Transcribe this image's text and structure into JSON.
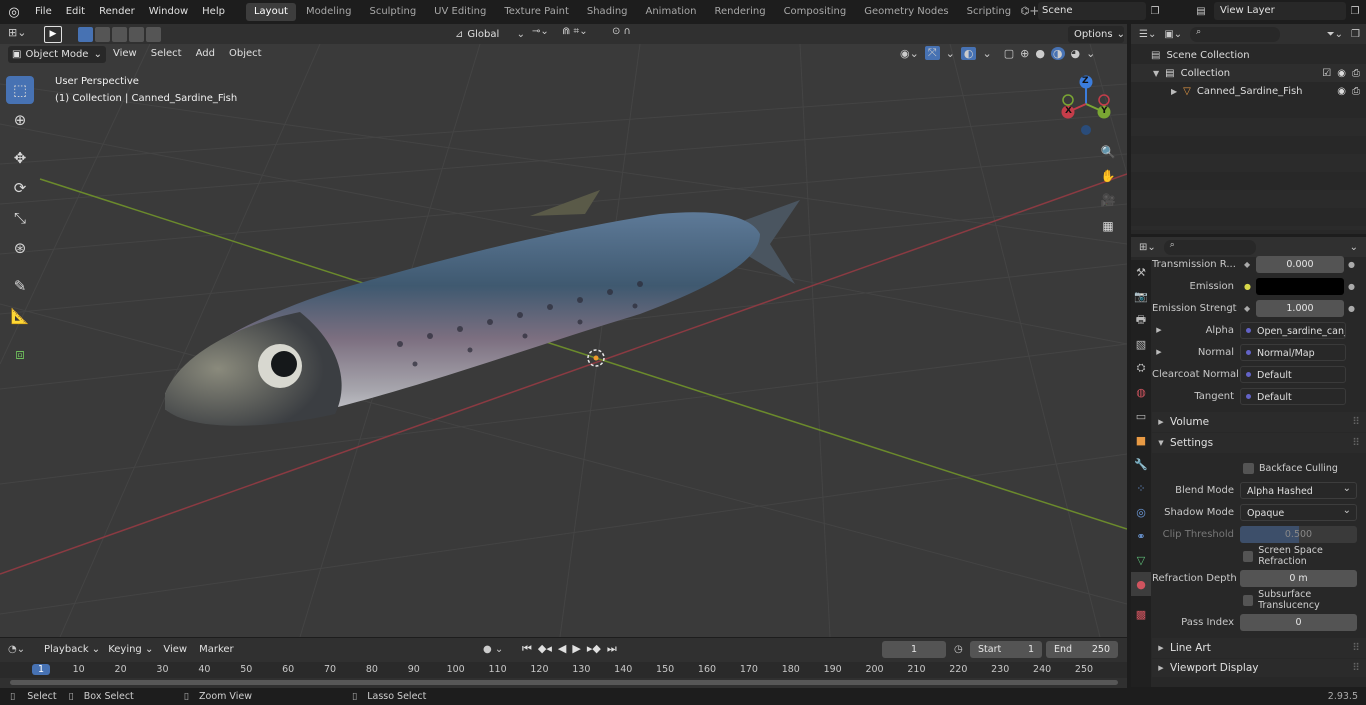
{
  "menu": {
    "items": [
      "File",
      "Edit",
      "Render",
      "Window",
      "Help"
    ]
  },
  "workspaces": {
    "tabs": [
      "Layout",
      "Modeling",
      "Sculpting",
      "UV Editing",
      "Texture Paint",
      "Shading",
      "Animation",
      "Rendering",
      "Compositing",
      "Geometry Nodes",
      "Scripting"
    ],
    "active": "Layout",
    "add": "+"
  },
  "scene": {
    "name": "Scene",
    "view_layer": "View Layer"
  },
  "header": {
    "transform_orientation": "Global",
    "options": "Options"
  },
  "viewport_header": {
    "mode": "Object Mode",
    "menus": [
      "View",
      "Select",
      "Add",
      "Object"
    ]
  },
  "viewport": {
    "perspective_label": "User Perspective",
    "collection_label": "(1) Collection | Canned_Sardine_Fish"
  },
  "gizmo": {
    "z": "Z",
    "y": "Y",
    "x": "X"
  },
  "outliner": {
    "root": "Scene Collection",
    "collection": "Collection",
    "object": "Canned_Sardine_Fish"
  },
  "properties": {
    "rows": [
      {
        "label": "Transmission R...",
        "value": "0.000"
      },
      {
        "label": "Emission",
        "value": ""
      },
      {
        "label": "Emission Strengt",
        "value": "1.000"
      }
    ],
    "links": [
      {
        "label": "Alpha",
        "value": "Open_sardine_can_s..."
      },
      {
        "label": "Normal",
        "value": "Normal/Map"
      },
      {
        "label": "Clearcoat Normal",
        "value": "Default"
      },
      {
        "label": "Tangent",
        "value": "Default"
      }
    ],
    "sections": {
      "volume": "Volume",
      "settings": "Settings",
      "line_art": "Line Art",
      "viewport_display": "Viewport Display"
    },
    "settings": {
      "backface_culling": "Backface Culling",
      "blend_mode_label": "Blend Mode",
      "blend_mode": "Alpha Hashed",
      "shadow_mode_label": "Shadow Mode",
      "shadow_mode": "Opaque",
      "clip_threshold_label": "Clip Threshold",
      "clip_threshold": "0.500",
      "screen_space_refraction": "Screen Space Refraction",
      "refraction_depth_label": "Refraction Depth",
      "refraction_depth": "0 m",
      "subsurface_translucency": "Subsurface Translucency",
      "pass_index_label": "Pass Index",
      "pass_index": "0"
    }
  },
  "timeline": {
    "menus": [
      "Playback",
      "Keying",
      "View",
      "Marker"
    ],
    "current_frame": "1",
    "start_label": "Start",
    "start": "1",
    "end_label": "End",
    "end": "250",
    "ruler": [
      "1",
      "10",
      "20",
      "30",
      "40",
      "50",
      "60",
      "70",
      "80",
      "90",
      "100",
      "110",
      "120",
      "130",
      "140",
      "150",
      "160",
      "170",
      "180",
      "190",
      "200",
      "210",
      "220",
      "230",
      "240",
      "250"
    ]
  },
  "status": {
    "select": "Select",
    "box_select": "Box Select",
    "zoom_view": "Zoom View",
    "lasso_select": "Lasso Select",
    "version": "2.93.5"
  },
  "colors": {
    "accent": "#4772b3",
    "x_axis": "#c53d4a",
    "y_axis": "#7aa633",
    "z_axis": "#3b7ddd"
  }
}
